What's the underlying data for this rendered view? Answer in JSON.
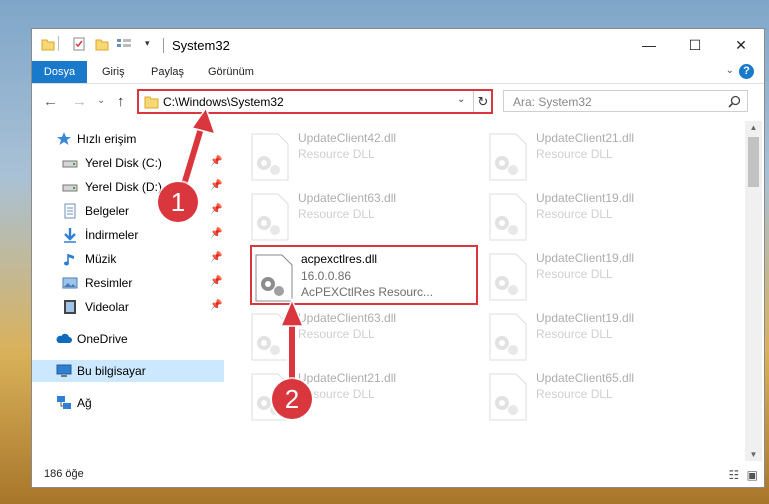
{
  "window": {
    "title": "System32",
    "controls": {
      "minimize": "—",
      "maximize": "☐",
      "close": "✕"
    }
  },
  "ribbon": {
    "tabs": [
      "Dosya",
      "Giriş",
      "Paylaş",
      "Görünüm"
    ],
    "help": "?"
  },
  "navigation": {
    "back": "←",
    "forward": "→",
    "recent": "⌄",
    "up": "↑",
    "address": "C:\\Windows\\System32",
    "refresh": "↻",
    "search_placeholder": "Ara: System32"
  },
  "nav_pane": {
    "quick_access": "Hızlı erişim",
    "pinned": [
      {
        "label": "Yerel Disk (C:)",
        "icon": "drive-icon"
      },
      {
        "label": "Yerel Disk (D:)",
        "icon": "drive-icon"
      },
      {
        "label": "Belgeler",
        "icon": "documents-icon"
      },
      {
        "label": "İndirmeler",
        "icon": "downloads-icon"
      },
      {
        "label": "Müzik",
        "icon": "music-icon"
      },
      {
        "label": "Resimler",
        "icon": "pictures-icon"
      },
      {
        "label": "Videolar",
        "icon": "videos-icon"
      }
    ],
    "onedrive": "OneDrive",
    "this_pc": "Bu bilgisayar",
    "network": "Ağ"
  },
  "files": {
    "left": [
      {
        "name": "UpdateClient42.dll",
        "line1": "Resource DLL",
        "line2": ""
      },
      {
        "name": "UpdateClient63.dll",
        "line1": "Resource DLL",
        "line2": ""
      },
      {
        "name": "acpexctlres.dll",
        "line1": "16.0.0.86",
        "line2": "AcPEXCtlRes Resourc..."
      },
      {
        "name": "UpdateClient63.dll",
        "line1": "Resource DLL",
        "line2": ""
      },
      {
        "name": "UpdateClient21.dll",
        "line1": "Resource DLL",
        "line2": ""
      }
    ],
    "right": [
      {
        "name": "UpdateClient21.dll",
        "line1": "Resource DLL"
      },
      {
        "name": "UpdateClient19.dll",
        "line1": "Resource DLL"
      },
      {
        "name": "UpdateClient19.dll",
        "line1": "Resource DLL"
      },
      {
        "name": "UpdateClient19.dll",
        "line1": "Resource DLL"
      },
      {
        "name": "UpdateClient65.dll",
        "line1": "Resource DLL"
      }
    ]
  },
  "status": {
    "item_count": "186 öğe"
  },
  "annotations": {
    "step1": "1",
    "step2": "2"
  },
  "colors": {
    "accent": "#1979ca",
    "highlight": "#d9363e",
    "selection": "#cce8ff"
  }
}
